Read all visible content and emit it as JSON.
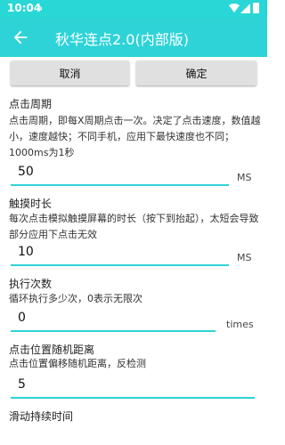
{
  "status_bar": {
    "time": "10:04"
  },
  "app_bar": {
    "title": "秋华连点2.0(内部版)"
  },
  "buttons": {
    "cancel": "取消",
    "confirm": "确定"
  },
  "settings": [
    {
      "label": "点击周期",
      "description": "点击周期，即每X周期点击一次。决定了点击速度，数值越小，速度越快；不同手机，应用下最快速度也不同；1000ms为1秒",
      "value": "50",
      "unit": "MS"
    },
    {
      "label": "触摸时长",
      "description": "每次点击模拟触摸屏幕的时长（按下到抬起），太短会导致部分应用下点击无效",
      "value": "10",
      "unit": "MS"
    },
    {
      "label": "执行次数",
      "description": "循环执行多少次，0表示无限次",
      "value": "0",
      "unit": "times"
    },
    {
      "label": "点击位置随机距离",
      "description": "点击位置偏移随机距离，反检测",
      "value": "5",
      "unit": ""
    },
    {
      "label": "滑动持续时间",
      "description": "",
      "value": "",
      "unit": ""
    }
  ]
}
